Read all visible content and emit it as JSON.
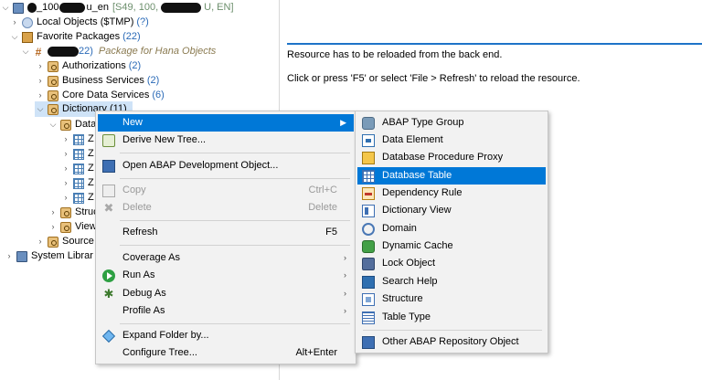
{
  "tree": {
    "root": {
      "suffix": "_100",
      "suffix2": "u_en",
      "info": "[S49, 100,",
      "info2": "U, EN]"
    },
    "local_objects": {
      "label": "Local Objects ($TMP)",
      "count": "(?)"
    },
    "favorite_packages": {
      "label": "Favorite Packages",
      "count": "(22)"
    },
    "package": {
      "count": "22)",
      "desc": "Package for Hana Objects"
    },
    "authorizations": {
      "label": "Authorizations",
      "count": "(2)"
    },
    "business_services": {
      "label": "Business Services",
      "count": "(2)"
    },
    "core_data_services": {
      "label": "Core Data Services",
      "count": "(6)"
    },
    "dictionary": {
      "label": "Dictionary (11)"
    },
    "data": {
      "label": "Data"
    },
    "z1": "Z",
    "z2": "Z",
    "z3": "Z",
    "z4": "Z",
    "z5": "Z",
    "struc": "Struc",
    "views": "View",
    "source": "Source",
    "system_library": "System Librar"
  },
  "editor": {
    "line1": "Resource has to be reloaded from the back end.",
    "line2": "Click or press 'F5' or select 'File > Refresh' to reload the resource."
  },
  "context_menu": {
    "new": "New",
    "derive_tree": "Derive New Tree...",
    "open_object": "Open ABAP Development Object...",
    "copy": "Copy",
    "copy_sc": "Ctrl+C",
    "delete": "Delete",
    "delete_sc": "Delete",
    "refresh": "Refresh",
    "refresh_sc": "F5",
    "coverage_as": "Coverage As",
    "run_as": "Run As",
    "debug_as": "Debug As",
    "profile_as": "Profile As",
    "expand_folder": "Expand Folder by...",
    "configure_tree": "Configure Tree...",
    "configure_tree_sc": "Alt+Enter"
  },
  "submenu": {
    "items": [
      {
        "label": "ABAP Type Group",
        "icon": "type-group-icon"
      },
      {
        "label": "Data Element",
        "icon": "data-element-icon"
      },
      {
        "label": "Database Procedure Proxy",
        "icon": "procedure-proxy-icon"
      },
      {
        "label": "Database Table",
        "icon": "database-table-icon"
      },
      {
        "label": "Dependency Rule",
        "icon": "dependency-rule-icon"
      },
      {
        "label": "Dictionary View",
        "icon": "dictionary-view-icon"
      },
      {
        "label": "Domain",
        "icon": "domain-icon"
      },
      {
        "label": "Dynamic Cache",
        "icon": "dynamic-cache-icon"
      },
      {
        "label": "Lock Object",
        "icon": "lock-object-icon"
      },
      {
        "label": "Search Help",
        "icon": "search-help-icon"
      },
      {
        "label": "Structure",
        "icon": "structure-icon"
      },
      {
        "label": "Table Type",
        "icon": "table-type-icon"
      }
    ],
    "other": "Other ABAP Repository Object",
    "highlight_color": "#0078d7"
  }
}
